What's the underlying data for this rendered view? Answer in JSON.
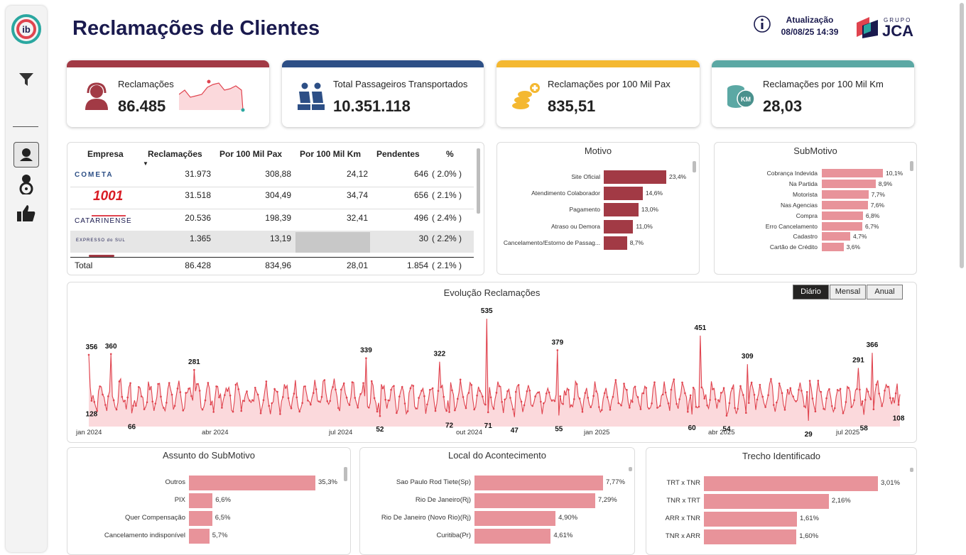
{
  "header": {
    "title": "Reclamações de Clientes",
    "update_label": "Atualização",
    "update_time": "08/08/25 14:39",
    "logo_small": "GRUPO",
    "logo_big": "JCA"
  },
  "sidebar": {
    "icons": [
      "filter-icon",
      "agent-icon",
      "driver-icon",
      "thumbs-up-icon"
    ]
  },
  "kpis": [
    {
      "label": "Reclamações",
      "value": "86.485",
      "color": "#a23a45",
      "icon": "headset-icon"
    },
    {
      "label": "Total Passageiros Transportados",
      "value": "10.351.118",
      "color": "#2d4f86",
      "icon": "passengers-icon"
    },
    {
      "label": "Reclamações por 100 Mil Pax",
      "value": "835,51",
      "color": "#f4b831",
      "icon": "coins-icon"
    },
    {
      "label": "Reclamações por 100 Mil Km",
      "value": "28,03",
      "color": "#5ba8a4",
      "icon": "km-icon"
    }
  ],
  "company_table": {
    "headers": [
      "Empresa",
      "Reclamações",
      "Por 100 Mil Pax",
      "Por 100 Mil Km",
      "Pendentes",
      "%"
    ],
    "rows": [
      {
        "logo": "COMETA",
        "rec": "31.973",
        "pax": "308,88",
        "km": "24,12",
        "pend": "646",
        "pct": "( 2.0% )"
      },
      {
        "logo": "1001",
        "rec": "31.518",
        "pax": "304,49",
        "km": "34,74",
        "pend": "656",
        "pct": "( 2.1% )"
      },
      {
        "logo": "CATARINENSE",
        "rec": "20.536",
        "pax": "198,39",
        "km": "32,41",
        "pend": "496",
        "pct": "( 2.4% )"
      },
      {
        "logo": "EXPRESSO do SUL",
        "rec": "1.365",
        "pax": "13,19",
        "km": "",
        "pend": "30",
        "pct": "( 2.2% )"
      }
    ],
    "total": {
      "label": "Total",
      "rec": "86.428",
      "pax": "834,96",
      "km": "28,01",
      "pend": "1.854",
      "pct": "( 2.1% )"
    }
  },
  "motivo": {
    "title": "Motivo",
    "items": [
      {
        "label": "Site Oficial",
        "value": 23.4,
        "text": "23,4%"
      },
      {
        "label": "Atendimento Colaborador",
        "value": 14.6,
        "text": "14,6%"
      },
      {
        "label": "Pagamento",
        "value": 13.0,
        "text": "13,0%"
      },
      {
        "label": "Atraso ou Demora",
        "value": 11.0,
        "text": "11,0%"
      },
      {
        "label": "Cancelamento/Estorno de Passag...",
        "value": 8.7,
        "text": "8,7%"
      }
    ]
  },
  "submotivo": {
    "title": "SubMotivo",
    "items": [
      {
        "label": "Cobrança Indevida",
        "value": 10.1,
        "text": "10,1%"
      },
      {
        "label": "Na Partida",
        "value": 8.9,
        "text": "8,9%"
      },
      {
        "label": "Motorista",
        "value": 7.7,
        "text": "7,7%"
      },
      {
        "label": "Nas Agencias",
        "value": 7.6,
        "text": "7,6%"
      },
      {
        "label": "Compra",
        "value": 6.8,
        "text": "6,8%"
      },
      {
        "label": "Erro Cancelamento",
        "value": 6.7,
        "text": "6,7%"
      },
      {
        "label": "Cadastro",
        "value": 4.7,
        "text": "4,7%"
      },
      {
        "label": "Cartão de Crédito",
        "value": 3.6,
        "text": "3,6%"
      }
    ]
  },
  "evolucao": {
    "title": "Evolução Reclamações",
    "buttons": [
      "Diário",
      "Mensal",
      "Anual"
    ],
    "active_button": "Diário",
    "x_ticks": [
      "jan 2024",
      "abr 2024",
      "jul 2024",
      "out 2024",
      "jan 2025",
      "abr 2025",
      "jul 2025"
    ],
    "labels": [
      "356",
      "128",
      "360",
      "66",
      "281",
      "339",
      "52",
      "322",
      "72",
      "535",
      "71",
      "47",
      "379",
      "55",
      "451",
      "60",
      "54",
      "309",
      "29",
      "291",
      "58",
      "366",
      "108"
    ]
  },
  "assunto": {
    "title": "Assunto do SubMotivo",
    "items": [
      {
        "label": "Outros",
        "value": 35.3,
        "text": "35,3%"
      },
      {
        "label": "PIX",
        "value": 6.6,
        "text": "6,6%"
      },
      {
        "label": "Quer Compensação",
        "value": 6.5,
        "text": "6,5%"
      },
      {
        "label": "Cancelamento indisponível",
        "value": 5.7,
        "text": "5,7%"
      }
    ]
  },
  "local": {
    "title": "Local do Acontecimento",
    "items": [
      {
        "label": "Sao Paulo Rod Tiete(Sp)",
        "value": 7.77,
        "text": "7,77%"
      },
      {
        "label": "Rio De Janeiro(Rj)",
        "value": 7.29,
        "text": "7,29%"
      },
      {
        "label": "Rio De Janeiro (Novo Rio)(Rj)",
        "value": 4.9,
        "text": "4,90%"
      },
      {
        "label": "Curitiba(Pr)",
        "value": 4.61,
        "text": "4,61%"
      }
    ]
  },
  "trecho": {
    "title": "Trecho Identificado",
    "items": [
      {
        "label": "TRT x TNR",
        "value": 3.01,
        "text": "3,01%"
      },
      {
        "label": "TNR x TRT",
        "value": 2.16,
        "text": "2,16%"
      },
      {
        "label": "ARR x TNR",
        "value": 1.61,
        "text": "1,61%"
      },
      {
        "label": "TNR x ARR",
        "value": 1.6,
        "text": "1,60%"
      }
    ]
  },
  "colors": {
    "dark_red": "#a23a45",
    "pink": "#e8939a",
    "line": "#e0444f",
    "fill": "#fbd9dc"
  }
}
